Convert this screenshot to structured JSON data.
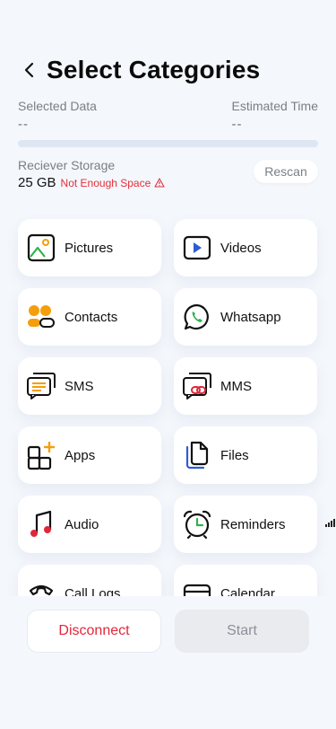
{
  "header": {
    "title": "Select Categories"
  },
  "stats": {
    "selected_label": "Selected Data",
    "selected_value": "--",
    "estimated_label": "Estimated Time",
    "estimated_value": "--",
    "progress_fraction": 0
  },
  "storage": {
    "label": "Reciever Storage",
    "size": "25 GB",
    "warning": "Not Enough Space",
    "rescan_label": "Rescan"
  },
  "categories": [
    {
      "label": "Pictures",
      "icon": "pictures-icon"
    },
    {
      "label": "Videos",
      "icon": "videos-icon"
    },
    {
      "label": "Contacts",
      "icon": "contacts-icon"
    },
    {
      "label": "Whatsapp",
      "icon": "whatsapp-icon"
    },
    {
      "label": "SMS",
      "icon": "sms-icon"
    },
    {
      "label": "MMS",
      "icon": "mms-icon"
    },
    {
      "label": "Apps",
      "icon": "apps-icon"
    },
    {
      "label": "Files",
      "icon": "files-icon"
    },
    {
      "label": "Audio",
      "icon": "audio-icon"
    },
    {
      "label": "Reminders",
      "icon": "reminders-icon"
    },
    {
      "label": "Call Logs",
      "icon": "call-logs-icon"
    },
    {
      "label": "Calendar",
      "icon": "calendar-icon"
    }
  ],
  "actions": {
    "disconnect_label": "Disconnect",
    "start_label": "Start"
  },
  "colors": {
    "accent_orange": "#f59e0b",
    "accent_red": "#e0283a",
    "accent_blue": "#2f5bd3",
    "whatsapp_green": "#2fb24c",
    "background": "#f4f7fc"
  }
}
